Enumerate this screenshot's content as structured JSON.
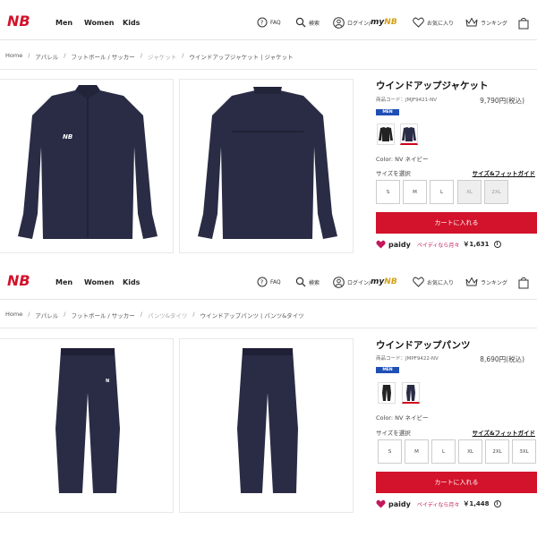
{
  "header": {
    "nav": [
      "Men",
      "Women",
      "Kids"
    ],
    "faq": "FAQ",
    "search": "検索",
    "login": "ログイン/",
    "mynb_prefix": "my",
    "mynb_brand": "NB",
    "favorites": "お気に入り",
    "ranking": "ランキング"
  },
  "products": [
    {
      "breadcrumb": [
        "Home",
        "アパレル",
        "フットボール / サッカー",
        "ジャケット",
        "ウインドアップジャケット | ジャケット"
      ],
      "title": "ウインドアップジャケット",
      "code": "商品コード：JMJF9421-NV",
      "price": "9,790円(税込)",
      "badge": "MEN",
      "color": "Color: NV ネイビー",
      "size_heading": "サイズを選択",
      "size_fit": "サイズ&フィットガイド",
      "sizes": [
        "S",
        "M",
        "L",
        "XL",
        "2XL"
      ],
      "sizes_out_of_stock": [
        "XL",
        "2XL"
      ],
      "cart": "カートに入れる",
      "paidy_logo": "paidy",
      "paidy_text": "ペイディなら月々",
      "paidy_price": "￥1,631"
    },
    {
      "breadcrumb": [
        "Home",
        "アパレル",
        "フットボール / サッカー",
        "パンツ&タイツ",
        "ウインドアップパンツ | パンツ&タイツ"
      ],
      "title": "ウインドアップパンツ",
      "code": "商品コード：JMPF9422-NV",
      "price": "8,690円(税込)",
      "badge": "MEN",
      "color": "Color: NV ネイビー",
      "size_heading": "サイズを選択",
      "size_fit": "サイズ&フィットガイド",
      "sizes": [
        "S",
        "M",
        "L",
        "XL",
        "2XL",
        "3XL"
      ],
      "sizes_out_of_stock": [],
      "cart": "カートに入れる",
      "paidy_logo": "paidy",
      "paidy_text": "ペイディなら月々",
      "paidy_price": "￥1,448"
    }
  ],
  "colors": {
    "brand_red": "#d3122b",
    "badge_blue": "#1f4fb5",
    "product_navy": "#2a2c45",
    "paidy_pink": "#c2185b"
  }
}
